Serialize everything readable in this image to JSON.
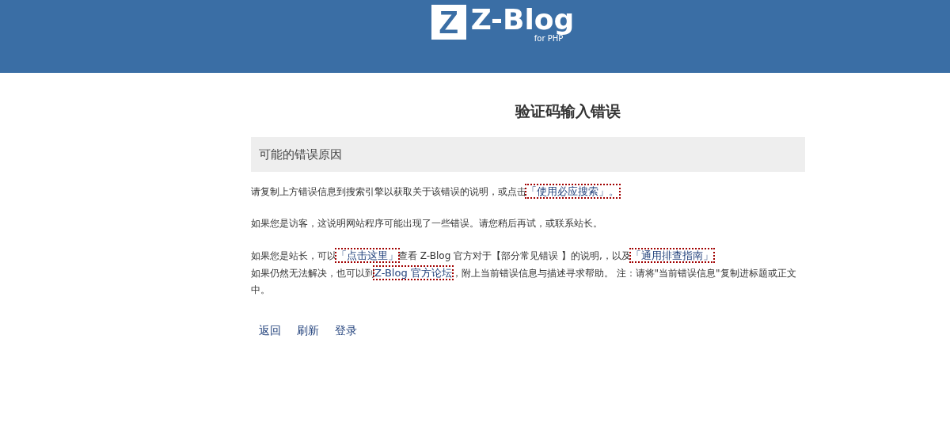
{
  "header": {
    "logo_mark": "Z",
    "logo_text": "Z-Blog",
    "logo_sub": "for PHP"
  },
  "title": "验证码输入错误",
  "section_heading": "可能的错误原因",
  "paragraphs": [
    [
      {
        "kind": "text",
        "text": "请复制上方错误信息到搜索引擎以获取关于该错误的说明，或点击"
      },
      {
        "kind": "link",
        "text": "「使用必应搜索」。"
      }
    ],
    [
      {
        "kind": "text",
        "text": "如果您是访客，这说明网站程序可能出现了一些错误。请您稍后再试，或联系站长。"
      }
    ],
    [
      {
        "kind": "text",
        "text": "如果您是站长，可以"
      },
      {
        "kind": "link",
        "text": "「点击这里」"
      },
      {
        "kind": "text",
        "text": "查看 Z-Blog 官方对于【部分常见错误 】的说明,，以及"
      },
      {
        "kind": "link",
        "text": "「通用排查指南」"
      },
      {
        "kind": "break"
      },
      {
        "kind": "text",
        "text": "如果仍然无法解决，也可以到"
      },
      {
        "kind": "link",
        "text": "Z-Blog 官方论坛"
      },
      {
        "kind": "text",
        "text": "，附上当前错误信息与描述寻求帮助。 注：请将\"当前错误信息\"复制进标题或正文中。"
      }
    ]
  ],
  "actions": [
    "返回",
    "刷新",
    "登录"
  ]
}
